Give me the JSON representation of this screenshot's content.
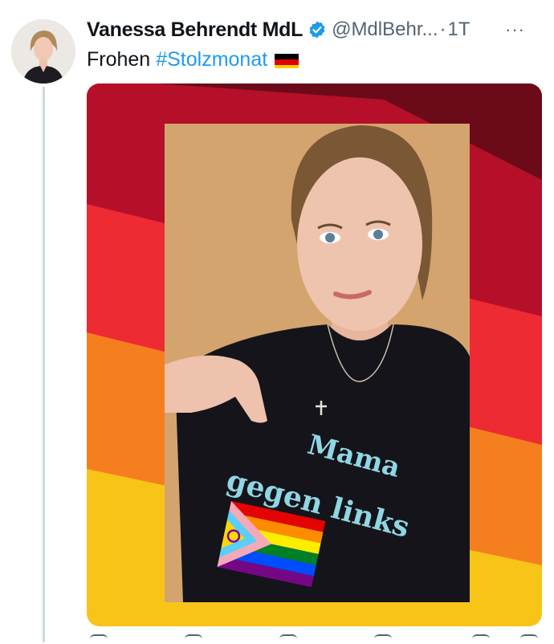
{
  "tweet": {
    "display_name": "Vanessa Behrendt MdL",
    "handle": "@MdlBehr...",
    "separator": "·",
    "timestamp": "1T",
    "more_label": "···",
    "text_prefix": "Frohen",
    "hashtag": "#Stolzmonat",
    "flag_icon": "germany-flag-icon"
  },
  "image": {
    "shirt_line1": "Mama",
    "shirt_line2": "gegen links",
    "stripe_colors": [
      "#6b0a18",
      "#b50f2a",
      "#ee2a33",
      "#f57f1f",
      "#f9c418"
    ]
  },
  "colors": {
    "accent": "#1d9bf0",
    "verified": "#1d9bf0",
    "secondary_text": "#536471"
  }
}
